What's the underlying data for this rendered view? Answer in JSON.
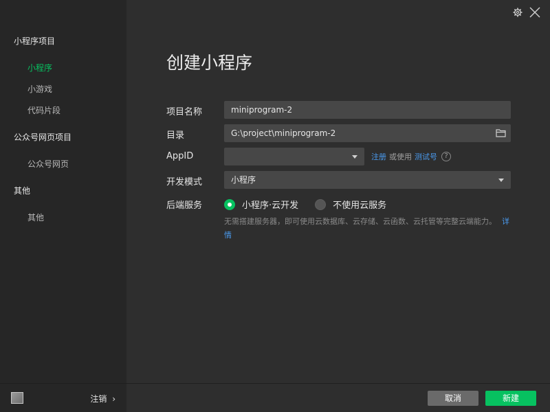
{
  "sidebar": {
    "groups": [
      {
        "label": "小程序项目",
        "items": [
          {
            "label": "小程序",
            "active": true
          },
          {
            "label": "小游戏"
          },
          {
            "label": "代码片段"
          }
        ]
      },
      {
        "label": "公众号网页项目",
        "items": [
          {
            "label": "公众号网页"
          }
        ]
      },
      {
        "label": "其他",
        "items": [
          {
            "label": "其他"
          }
        ]
      }
    ],
    "logout_label": "注销",
    "logout_arrow": "›"
  },
  "colors": {
    "accent": "#07c160",
    "link": "#4a9bef"
  },
  "form": {
    "title": "创建小程序",
    "project_name": {
      "label": "项目名称",
      "value": "miniprogram-2"
    },
    "directory": {
      "label": "目录",
      "value": "G:\\project\\miniprogram-2"
    },
    "appid": {
      "label": "AppID",
      "value": "",
      "register_link": "注册",
      "or_text": "或使用",
      "test_link": "测试号",
      "help": "?"
    },
    "dev_mode": {
      "label": "开发模式",
      "value": "小程序"
    },
    "backend": {
      "label": "后端服务",
      "options": [
        {
          "label": "小程序·云开发",
          "selected": true
        },
        {
          "label": "不使用云服务",
          "selected": false
        }
      ],
      "description": "无需搭建服务器，即可使用云数据库、云存储、云函数、云托管等完整云端能力。",
      "detail_link": "详情"
    }
  },
  "footer": {
    "cancel_label": "取消",
    "create_label": "新建"
  },
  "icons": {
    "settings": "gear-icon",
    "close": "close-icon",
    "folder": "folder-icon"
  }
}
